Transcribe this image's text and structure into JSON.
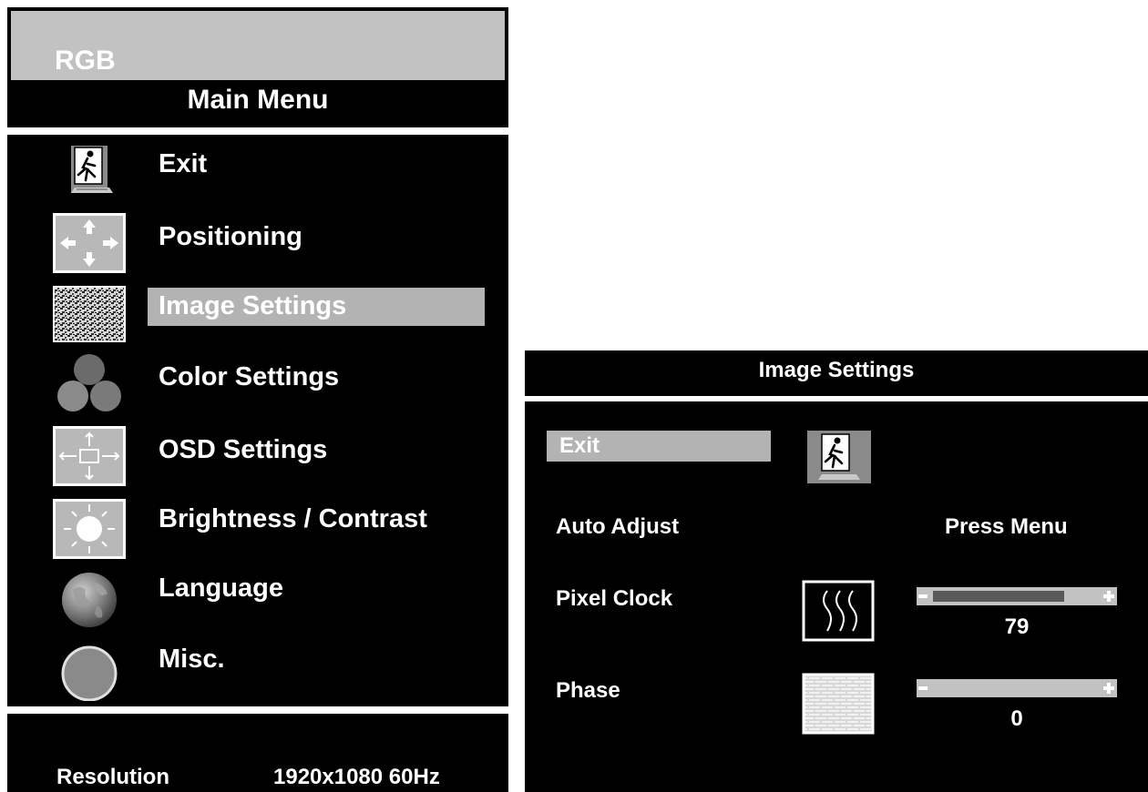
{
  "main_menu": {
    "source": "RGB",
    "title": "Main Menu",
    "items": [
      {
        "label": "Exit",
        "icon": "exit-icon",
        "selected": false
      },
      {
        "label": "Positioning",
        "icon": "positioning-icon",
        "selected": false
      },
      {
        "label": "Image Settings",
        "icon": "image-settings-icon",
        "selected": true
      },
      {
        "label": "Color Settings",
        "icon": "color-settings-icon",
        "selected": false
      },
      {
        "label": "OSD Settings",
        "icon": "osd-settings-icon",
        "selected": false
      },
      {
        "label": "Brightness / Contrast",
        "icon": "brightness-icon",
        "selected": false
      },
      {
        "label": "Language",
        "icon": "globe-icon",
        "selected": false
      },
      {
        "label": "Misc.",
        "icon": "misc-icon",
        "selected": false
      }
    ],
    "footer": {
      "resolution_label": "Resolution",
      "resolution_value": "1920x1080 60Hz"
    }
  },
  "image_settings": {
    "title": "Image Settings",
    "exit": {
      "label": "Exit",
      "icon": "exit-icon",
      "selected": true
    },
    "auto_adjust": {
      "label": "Auto Adjust",
      "value": "Press Menu"
    },
    "pixel_clock": {
      "label": "Pixel Clock",
      "icon": "wave-icon",
      "value": "79",
      "fill_fraction": 0.8
    },
    "phase": {
      "label": "Phase",
      "icon": "phase-pattern-icon",
      "value": "0",
      "fill_fraction": 0
    }
  },
  "colors": {
    "osd_bg": "#000000",
    "highlight": "#b3b3b3",
    "panel_gray": "#c2c2c2",
    "bar_fill": "#5a5a5a"
  }
}
